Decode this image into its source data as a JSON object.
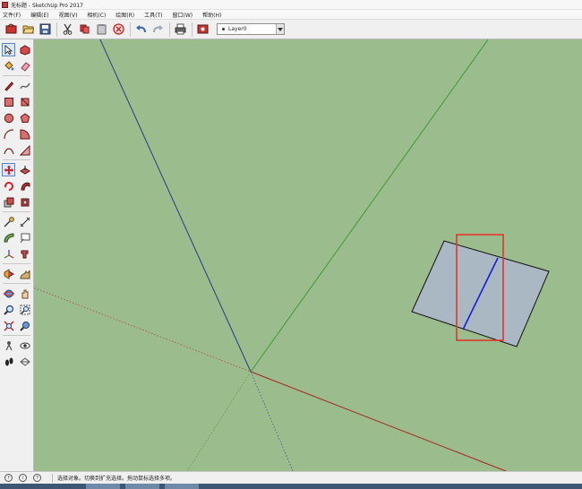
{
  "window": {
    "title": "无标题 - SketchUp Pro 2017"
  },
  "menubar": {
    "items": [
      "文件(F)",
      "编辑(E)",
      "视图(V)",
      "相机(C)",
      "绘图(R)",
      "工具(T)",
      "窗口(W)",
      "帮助(H)"
    ]
  },
  "toolbar": {
    "icons": [
      "get-started-icon",
      "open-folder-icon",
      "save-icon",
      "cut-icon",
      "copy-icon",
      "paste-icon",
      "erase-icon",
      "undo-icon",
      "redo-icon",
      "print-icon",
      "model-info-icon"
    ],
    "layer_value": "Layer0"
  },
  "palette": {
    "tools": [
      "select-icon",
      "make-component-icon",
      "paint-bucket-icon",
      "eraser-icon",
      "pencil-icon",
      "freehand-icon",
      "rectangle-icon",
      "rotated-rectangle-icon",
      "circle-icon",
      "polygon-icon",
      "arc-icon",
      "pie-icon",
      "two-point-arc-icon",
      "three-point-arc-icon",
      "move-icon",
      "push-pull-icon",
      "rotate-icon",
      "follow-me-icon",
      "scale-icon",
      "offset-icon",
      "tape-measure-icon",
      "dimension-icon",
      "protractor-icon",
      "text-icon",
      "axes-icon",
      "3d-text-icon",
      "section-plane-icon",
      "sandbox-icon",
      "orbit-icon",
      "pan-icon",
      "zoom-icon",
      "zoom-window-icon",
      "zoom-extents-icon",
      "previous-view-icon",
      "position-camera-icon",
      "look-around-icon",
      "walk-icon",
      "section-display-icon"
    ]
  },
  "colors": {
    "viewport_bg": "#9bbd8d",
    "blue_axis": "#233e86",
    "green_axis": "#3c9a35",
    "red_axis": "#a8201f",
    "face_fill": "#aab8c4",
    "selection_box": "#e2352b",
    "selected_edge": "#1420d6"
  },
  "status": {
    "message": "选择对象。切换到扩充选择。拖动鼠标选择多项。"
  }
}
